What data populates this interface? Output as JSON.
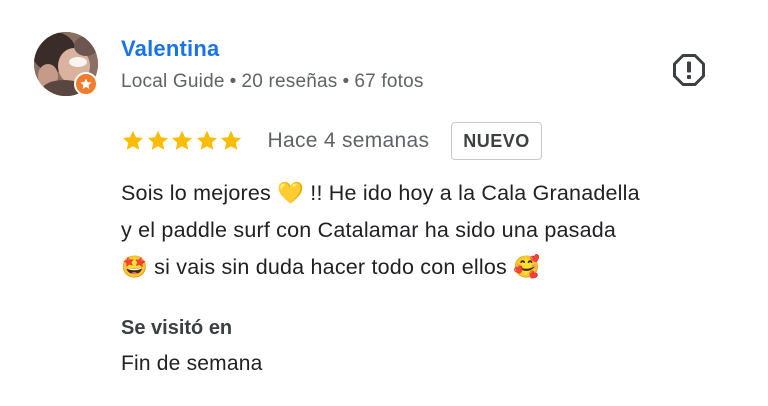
{
  "review": {
    "author_name": "Valentina",
    "author_meta": {
      "level": "Local Guide",
      "reviews": "20 reseñas",
      "photos": "67 fotos",
      "separator": "•"
    },
    "rating": 5,
    "date": "Hace 4 semanas",
    "badge": "NUEVO",
    "text_lines": [
      "Sois lo mejores 💛 !! He ido hoy a la Cala Granadella",
      "y el paddle surf con Catalamar ha sido una pasada",
      "🤩 si vais sin duda hacer todo con ellos 🥰"
    ],
    "visited": {
      "label": "Se visitó en",
      "value": "Fin de semana"
    }
  },
  "colors": {
    "author": "#1a73e8",
    "star": "#fbbc04",
    "guide_badge": "#f07c2c",
    "secondary_text": "#5f6368"
  },
  "icons": {
    "report": "report-flag-icon",
    "star": "star-icon",
    "guide": "local-guide-star-icon"
  }
}
